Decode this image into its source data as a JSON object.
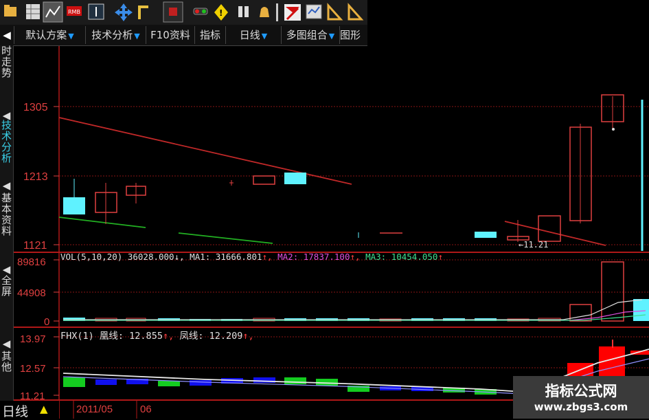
{
  "toolbar": {
    "icons": [
      "folder-icon",
      "grid-icon",
      "chart-grid-icon",
      "red-panel-icon",
      "dark-chart-icon",
      "move-cross-icon",
      "step-icon",
      "record-icon",
      "traffic-light-icon",
      "warning-icon",
      "binoculars-icon",
      "bell-icon",
      "pin-icon",
      "red-flag-icon",
      "screen-icon",
      "ruler-icon",
      "ruler-letter-icon"
    ]
  },
  "tabs": {
    "left_arrow": "◀",
    "items": [
      {
        "label": "默认方案",
        "arrow": "▼"
      },
      {
        "label": "技术分析",
        "arrow": "▼"
      },
      {
        "label": "F10资料",
        "arrow": ""
      },
      {
        "label": "指标",
        "arrow": ""
      },
      {
        "label": "日线",
        "arrow": "▼"
      },
      {
        "label": "多图组合",
        "arrow": "▼"
      },
      {
        "label": "图形彡",
        "arrow": ""
      }
    ]
  },
  "sidebar": {
    "items": [
      {
        "label": "时\n走\n势",
        "active": false
      },
      {
        "label": "技\n术\n分\n析",
        "active": true
      },
      {
        "label": "基\n本\n资\n料",
        "active": false
      },
      {
        "label": "全\n屏",
        "active": false
      },
      {
        "label": "其\n他",
        "active": false
      }
    ]
  },
  "price_axis": {
    "labels": [
      "1305",
      "1213",
      "1121"
    ]
  },
  "annotation_low": "←11.21",
  "vol_panel": {
    "prefix": "VOL(5,10,20)",
    "vol_value": "36028.000↓,",
    "ma1": "MA1: 31666.801",
    "ma1_arrow": "↑,",
    "ma2": "MA2: 17837.100",
    "ma2_arrow": "↑,",
    "ma3": "MA3: 10454.050",
    "ma3_arrow": "↑",
    "axis_labels": [
      "89816",
      "44908",
      "0"
    ]
  },
  "fhx_panel": {
    "prefix": "FHX(1)",
    "huang": "凰线: 12.855",
    "huang_arrow": "↑,",
    "feng": "凤线: 12.209",
    "feng_arrow": "↑,",
    "axis_labels": [
      "13.97",
      "12.57",
      "11.21"
    ]
  },
  "bottom_bar": {
    "period": "日线",
    "period_marker": "▲",
    "date1": "2011/05",
    "date2": "06"
  },
  "watermark": {
    "title": "指标公式网",
    "url": "www.zbgs3.com"
  },
  "colors": {
    "grid_red": "#b01818",
    "axis_text": "#e04040",
    "cyan": "#5ff2ff",
    "trend_line": "#c02828",
    "green_line": "#22b022",
    "ma2": "#e050e0",
    "ma3": "#40e090",
    "sidebar_active": "#3ad0e8"
  }
}
